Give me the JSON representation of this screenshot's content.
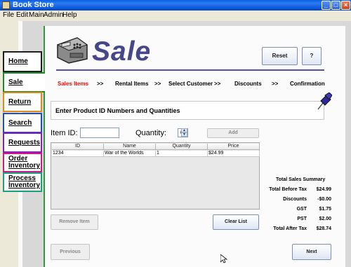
{
  "window": {
    "title": "Book Store"
  },
  "menu": [
    "File",
    "Edit",
    "Main",
    "Admin",
    "Help"
  ],
  "side_tabs": [
    "Home",
    "Sale",
    "Return",
    "Search",
    "Requests",
    "Order Inventory",
    "Process Inventory"
  ],
  "side_tabs_split": {
    "order": [
      "Order",
      "Inventory"
    ],
    "process": [
      "Process",
      "Inventory"
    ]
  },
  "header": {
    "heading": "Sale",
    "reset_label": "Reset",
    "help_label": "?"
  },
  "steps": [
    "Sales Items",
    "Rental Items",
    "Select Customer",
    "Discounts",
    "Confirmation"
  ],
  "step_separator": ">>",
  "instruction": "Enter Product ID Numbers and Quantities",
  "entry": {
    "item_id_label": "Item ID:",
    "item_id_value": "",
    "quantity_label": "Quantity:",
    "quantity_value": "0",
    "add_label": "Add"
  },
  "table": {
    "columns": [
      "ID",
      "Name",
      "Quantity",
      "Price"
    ],
    "rows": [
      [
        "1234",
        "War of the Worlds",
        "1",
        "$24.99"
      ]
    ]
  },
  "buttons": {
    "remove_label": "Remove Item",
    "clear_label": "Clear List",
    "previous_label": "Previous",
    "next_label": "Next"
  },
  "summary": {
    "title": "Total Sales Summary",
    "lines": [
      {
        "label": "Total Before Tax",
        "value": "$24.99"
      },
      {
        "label": "Discounts",
        "value": "-$0.00"
      },
      {
        "label": "GST",
        "value": "$1.75"
      },
      {
        "label": "PST",
        "value": "$2.00"
      },
      {
        "label": "Total After Tax",
        "value": "$28.74"
      }
    ]
  },
  "colors": {
    "heading": "#46468a",
    "active_step": "#e01010",
    "title_bar": "#0a5fe0",
    "sale_tab_border": "#1c8a2c"
  }
}
